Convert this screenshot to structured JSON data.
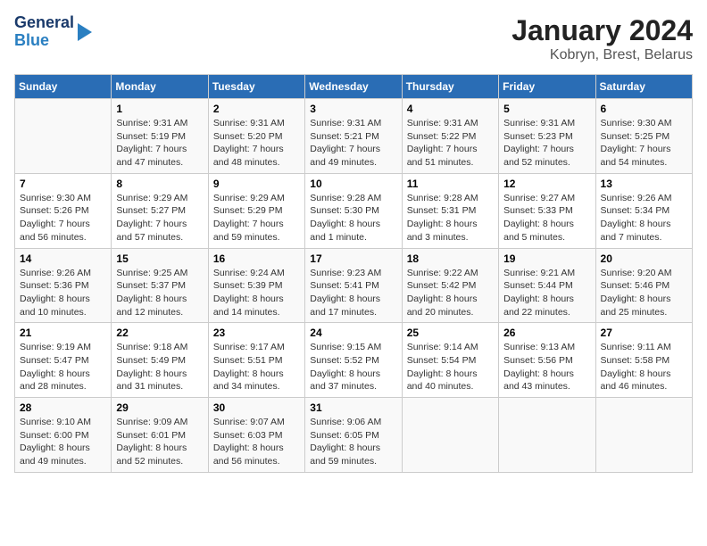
{
  "logo": {
    "general": "General",
    "blue": "Blue"
  },
  "title": "January 2024",
  "subtitle": "Kobryn, Brest, Belarus",
  "days_of_week": [
    "Sunday",
    "Monday",
    "Tuesday",
    "Wednesday",
    "Thursday",
    "Friday",
    "Saturday"
  ],
  "weeks": [
    [
      {
        "day": "",
        "sunrise": "",
        "sunset": "",
        "daylight": ""
      },
      {
        "day": "1",
        "sunrise": "Sunrise: 9:31 AM",
        "sunset": "Sunset: 5:19 PM",
        "daylight": "Daylight: 7 hours and 47 minutes."
      },
      {
        "day": "2",
        "sunrise": "Sunrise: 9:31 AM",
        "sunset": "Sunset: 5:20 PM",
        "daylight": "Daylight: 7 hours and 48 minutes."
      },
      {
        "day": "3",
        "sunrise": "Sunrise: 9:31 AM",
        "sunset": "Sunset: 5:21 PM",
        "daylight": "Daylight: 7 hours and 49 minutes."
      },
      {
        "day": "4",
        "sunrise": "Sunrise: 9:31 AM",
        "sunset": "Sunset: 5:22 PM",
        "daylight": "Daylight: 7 hours and 51 minutes."
      },
      {
        "day": "5",
        "sunrise": "Sunrise: 9:31 AM",
        "sunset": "Sunset: 5:23 PM",
        "daylight": "Daylight: 7 hours and 52 minutes."
      },
      {
        "day": "6",
        "sunrise": "Sunrise: 9:30 AM",
        "sunset": "Sunset: 5:25 PM",
        "daylight": "Daylight: 7 hours and 54 minutes."
      }
    ],
    [
      {
        "day": "7",
        "sunrise": "Sunrise: 9:30 AM",
        "sunset": "Sunset: 5:26 PM",
        "daylight": "Daylight: 7 hours and 56 minutes."
      },
      {
        "day": "8",
        "sunrise": "Sunrise: 9:29 AM",
        "sunset": "Sunset: 5:27 PM",
        "daylight": "Daylight: 7 hours and 57 minutes."
      },
      {
        "day": "9",
        "sunrise": "Sunrise: 9:29 AM",
        "sunset": "Sunset: 5:29 PM",
        "daylight": "Daylight: 7 hours and 59 minutes."
      },
      {
        "day": "10",
        "sunrise": "Sunrise: 9:28 AM",
        "sunset": "Sunset: 5:30 PM",
        "daylight": "Daylight: 8 hours and 1 minute."
      },
      {
        "day": "11",
        "sunrise": "Sunrise: 9:28 AM",
        "sunset": "Sunset: 5:31 PM",
        "daylight": "Daylight: 8 hours and 3 minutes."
      },
      {
        "day": "12",
        "sunrise": "Sunrise: 9:27 AM",
        "sunset": "Sunset: 5:33 PM",
        "daylight": "Daylight: 8 hours and 5 minutes."
      },
      {
        "day": "13",
        "sunrise": "Sunrise: 9:26 AM",
        "sunset": "Sunset: 5:34 PM",
        "daylight": "Daylight: 8 hours and 7 minutes."
      }
    ],
    [
      {
        "day": "14",
        "sunrise": "Sunrise: 9:26 AM",
        "sunset": "Sunset: 5:36 PM",
        "daylight": "Daylight: 8 hours and 10 minutes."
      },
      {
        "day": "15",
        "sunrise": "Sunrise: 9:25 AM",
        "sunset": "Sunset: 5:37 PM",
        "daylight": "Daylight: 8 hours and 12 minutes."
      },
      {
        "day": "16",
        "sunrise": "Sunrise: 9:24 AM",
        "sunset": "Sunset: 5:39 PM",
        "daylight": "Daylight: 8 hours and 14 minutes."
      },
      {
        "day": "17",
        "sunrise": "Sunrise: 9:23 AM",
        "sunset": "Sunset: 5:41 PM",
        "daylight": "Daylight: 8 hours and 17 minutes."
      },
      {
        "day": "18",
        "sunrise": "Sunrise: 9:22 AM",
        "sunset": "Sunset: 5:42 PM",
        "daylight": "Daylight: 8 hours and 20 minutes."
      },
      {
        "day": "19",
        "sunrise": "Sunrise: 9:21 AM",
        "sunset": "Sunset: 5:44 PM",
        "daylight": "Daylight: 8 hours and 22 minutes."
      },
      {
        "day": "20",
        "sunrise": "Sunrise: 9:20 AM",
        "sunset": "Sunset: 5:46 PM",
        "daylight": "Daylight: 8 hours and 25 minutes."
      }
    ],
    [
      {
        "day": "21",
        "sunrise": "Sunrise: 9:19 AM",
        "sunset": "Sunset: 5:47 PM",
        "daylight": "Daylight: 8 hours and 28 minutes."
      },
      {
        "day": "22",
        "sunrise": "Sunrise: 9:18 AM",
        "sunset": "Sunset: 5:49 PM",
        "daylight": "Daylight: 8 hours and 31 minutes."
      },
      {
        "day": "23",
        "sunrise": "Sunrise: 9:17 AM",
        "sunset": "Sunset: 5:51 PM",
        "daylight": "Daylight: 8 hours and 34 minutes."
      },
      {
        "day": "24",
        "sunrise": "Sunrise: 9:15 AM",
        "sunset": "Sunset: 5:52 PM",
        "daylight": "Daylight: 8 hours and 37 minutes."
      },
      {
        "day": "25",
        "sunrise": "Sunrise: 9:14 AM",
        "sunset": "Sunset: 5:54 PM",
        "daylight": "Daylight: 8 hours and 40 minutes."
      },
      {
        "day": "26",
        "sunrise": "Sunrise: 9:13 AM",
        "sunset": "Sunset: 5:56 PM",
        "daylight": "Daylight: 8 hours and 43 minutes."
      },
      {
        "day": "27",
        "sunrise": "Sunrise: 9:11 AM",
        "sunset": "Sunset: 5:58 PM",
        "daylight": "Daylight: 8 hours and 46 minutes."
      }
    ],
    [
      {
        "day": "28",
        "sunrise": "Sunrise: 9:10 AM",
        "sunset": "Sunset: 6:00 PM",
        "daylight": "Daylight: 8 hours and 49 minutes."
      },
      {
        "day": "29",
        "sunrise": "Sunrise: 9:09 AM",
        "sunset": "Sunset: 6:01 PM",
        "daylight": "Daylight: 8 hours and 52 minutes."
      },
      {
        "day": "30",
        "sunrise": "Sunrise: 9:07 AM",
        "sunset": "Sunset: 6:03 PM",
        "daylight": "Daylight: 8 hours and 56 minutes."
      },
      {
        "day": "31",
        "sunrise": "Sunrise: 9:06 AM",
        "sunset": "Sunset: 6:05 PM",
        "daylight": "Daylight: 8 hours and 59 minutes."
      },
      {
        "day": "",
        "sunrise": "",
        "sunset": "",
        "daylight": ""
      },
      {
        "day": "",
        "sunrise": "",
        "sunset": "",
        "daylight": ""
      },
      {
        "day": "",
        "sunrise": "",
        "sunset": "",
        "daylight": ""
      }
    ]
  ]
}
